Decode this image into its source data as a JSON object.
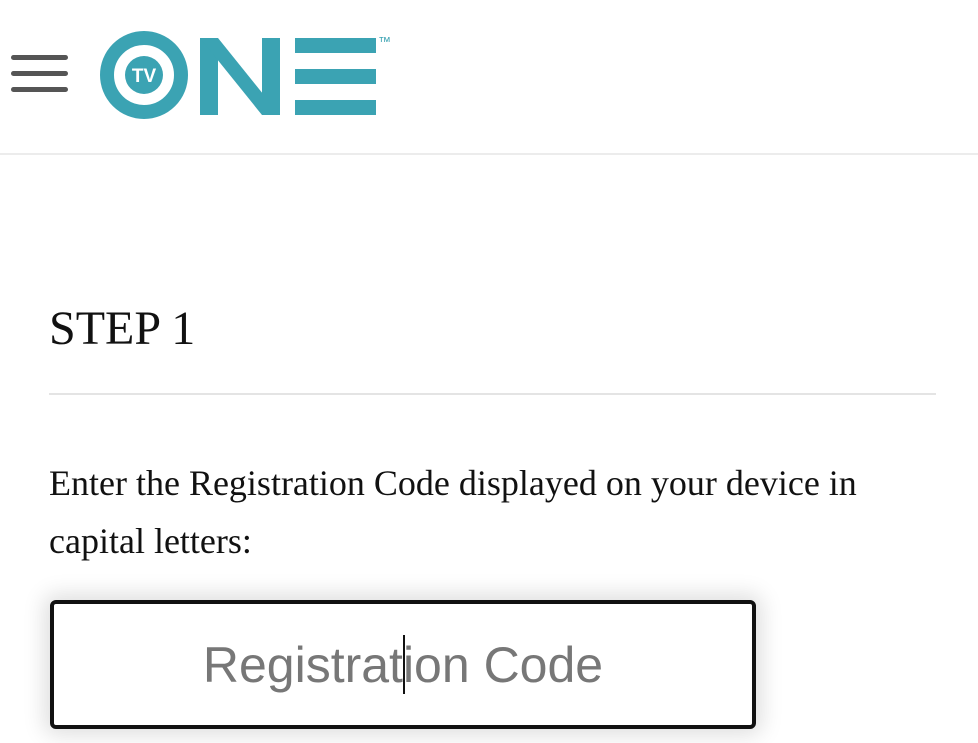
{
  "header": {
    "menu_icon": "hamburger-menu-icon",
    "logo": {
      "badge_text": "TV",
      "wordmark": "ONE",
      "trademark": "™",
      "color": "#3ba3b3"
    }
  },
  "main": {
    "step_title": "STEP 1",
    "instructions": "Enter the Registration Code displayed on your device in capital letters:",
    "registration_input": {
      "value": "",
      "placeholder": "Registration Code"
    }
  },
  "colors": {
    "brand_teal": "#3ba3b3",
    "text": "#111111",
    "icon_gray": "#555555",
    "placeholder": "#777777"
  }
}
